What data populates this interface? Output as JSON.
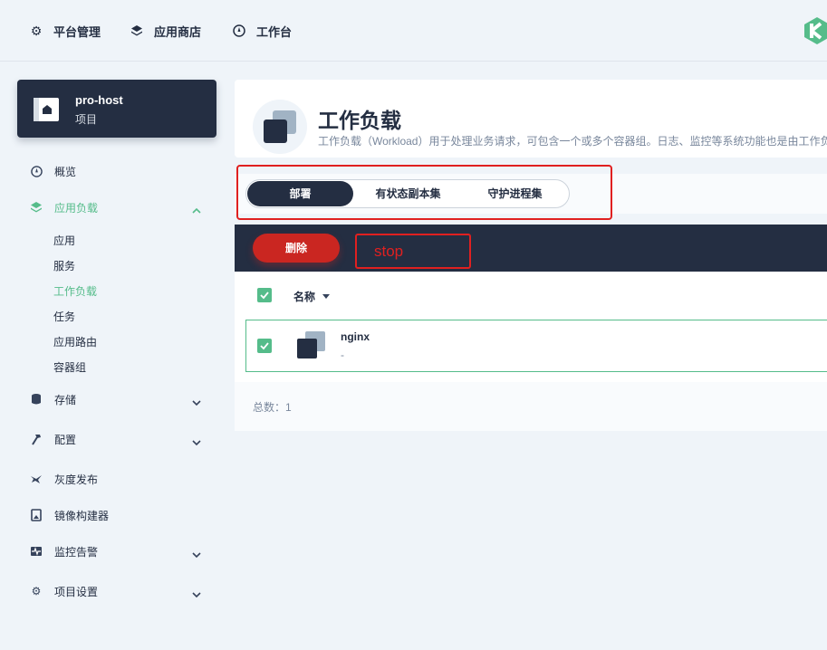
{
  "topnav": {
    "items": [
      {
        "label": "平台管理",
        "icon": "gear-icon"
      },
      {
        "label": "应用商店",
        "icon": "layers-icon"
      },
      {
        "label": "工作台",
        "icon": "dashboard-icon"
      }
    ],
    "logo": "kubesphere-logo"
  },
  "project": {
    "name": "pro-host",
    "type": "项目"
  },
  "sidebar": {
    "items": [
      {
        "label": "概览",
        "icon": "dashboard-icon"
      },
      {
        "label": "应用负载",
        "icon": "layers-icon",
        "expanded": true
      },
      {
        "label": "存储",
        "icon": "database-icon"
      },
      {
        "label": "配置",
        "icon": "hammer-icon"
      },
      {
        "label": "灰度发布",
        "icon": "bird-icon"
      },
      {
        "label": "镜像构建器",
        "icon": "image-builder-icon"
      },
      {
        "label": "监控告警",
        "icon": "monitor-icon"
      },
      {
        "label": "项目设置",
        "icon": "gear-icon"
      }
    ],
    "subitems": [
      "应用",
      "服务",
      "工作负载",
      "任务",
      "应用路由",
      "容器组"
    ],
    "active_subitem": "工作负载"
  },
  "header": {
    "title": "工作负载",
    "description": "工作负载（Workload）用于处理业务请求，可包含一个或多个容器组。日志、监控等系统功能也是由工作负"
  },
  "tabs": [
    {
      "label": "部署",
      "active": true
    },
    {
      "label": "有状态副本集",
      "active": false
    },
    {
      "label": "守护进程集",
      "active": false
    }
  ],
  "toolbar": {
    "delete_label": "删除",
    "annotation": "stop"
  },
  "table": {
    "column_name": "名称",
    "rows": [
      {
        "name": "nginx",
        "sub": "-",
        "checked": true
      }
    ],
    "total_label": "总数：1"
  },
  "colors": {
    "accent": "#55bc8a",
    "dark": "#242e42",
    "danger": "#ca2621",
    "annotation": "#e02020"
  }
}
